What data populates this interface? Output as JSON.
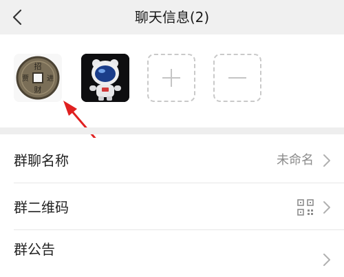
{
  "header": {
    "title": "聊天信息(2)",
    "back_icon": "chevron-left-icon"
  },
  "members": {
    "items": [
      {
        "name": "member-1",
        "avatar_icon": "ancient-coin-avatar"
      },
      {
        "name": "member-2",
        "avatar_icon": "astronaut-avatar"
      }
    ],
    "add_icon": "plus-icon",
    "remove_icon": "minus-icon"
  },
  "settings": {
    "rows": [
      {
        "label": "群聊名称",
        "value": "未命名"
      },
      {
        "label": "群二维码",
        "value_icon": "qr-code-icon"
      },
      {
        "label": "群公告"
      }
    ]
  },
  "colors": {
    "header_bg": "#f0f0f0",
    "annotation_arrow": "#e02020",
    "secondary_text": "#8c8c8c"
  }
}
